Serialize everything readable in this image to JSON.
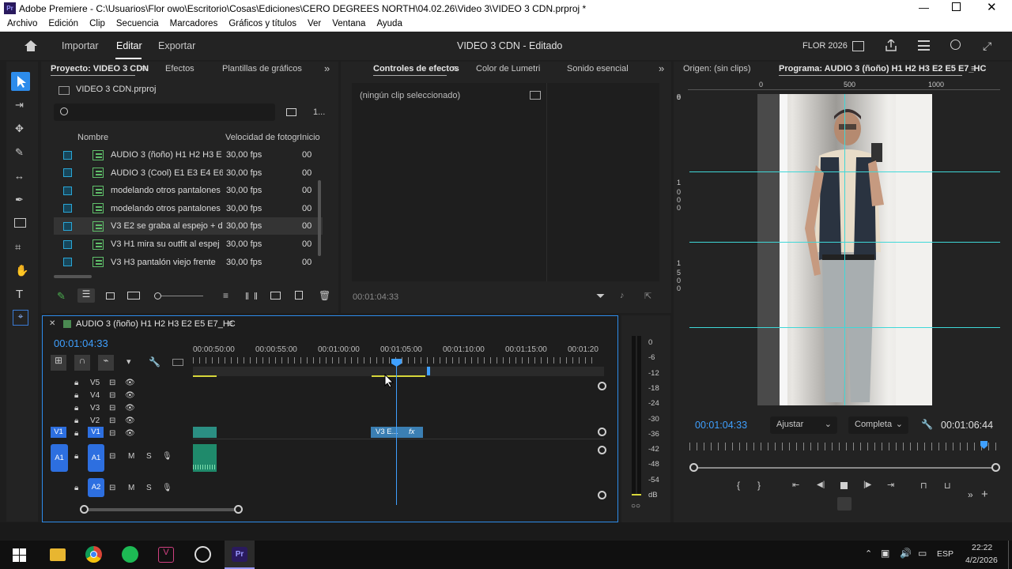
{
  "window": {
    "title": "Adobe Premiere - C:\\Usuarios\\Flor owo\\Escritorio\\Cosas\\Ediciones\\CERO DEGREES NORTH\\04.02.26\\Video 3\\VIDEO 3 CDN.prproj *",
    "app_icon": "Pr"
  },
  "menu": [
    "Archivo",
    "Edición",
    "Clip",
    "Secuencia",
    "Marcadores",
    "Gráficos y títulos",
    "Ver",
    "Ventana",
    "Ayuda"
  ],
  "appbar": {
    "tabs": [
      "Importar",
      "Editar",
      "Exportar"
    ],
    "active_tab": "Editar",
    "center_title": "VIDEO 3 CDN - Editado",
    "user": "FLOR 2026"
  },
  "project": {
    "tabs": [
      "Proyecto: VIDEO 3 CDN",
      "Efectos",
      "Plantillas de gráficos"
    ],
    "file": "VIDEO 3 CDN.prproj",
    "item_count": "1...",
    "columns": [
      "Nombre",
      "Velocidad de fotogr",
      "Inicio"
    ],
    "items": [
      {
        "name": "AUDIO 3 (ñoño) H1 H2 H3 E",
        "fps": "30,00 fps",
        "start": "00"
      },
      {
        "name": "AUDIO 3 (Cool) E1 E3 E4 E6",
        "fps": "30,00 fps",
        "start": "00"
      },
      {
        "name": "modelando otros pantalones",
        "fps": "30,00 fps",
        "start": "00"
      },
      {
        "name": "modelando otros pantalones",
        "fps": "30,00 fps",
        "start": "00"
      },
      {
        "name": "V3 E2 se graba al espejo + d",
        "fps": "30,00 fps",
        "start": "00"
      },
      {
        "name": "V3 H1 mira su outfit al espej",
        "fps": "30,00 fps",
        "start": "00"
      },
      {
        "name": "V3 H3 pantalón viejo frente",
        "fps": "30,00 fps",
        "start": "00"
      }
    ]
  },
  "effects": {
    "tabs": [
      "Controles de efectos",
      "Color de Lumetri",
      "Sonido esencial"
    ],
    "no_clip": "(ningún clip seleccionado)",
    "timecode": "00:01:04:33"
  },
  "timeline": {
    "sequence": "AUDIO 3 (ñoño) H1 H2 H3 E2 E5 E7_HC",
    "timecode": "00:01:04:33",
    "ruler": [
      "00:00:50:00",
      "00:00:55:00",
      "00:01:00:00",
      "00:01:05:00",
      "00:01:10:00",
      "00:01:15:00",
      "00:01:20"
    ],
    "video_tracks": [
      "V5",
      "V4",
      "V3",
      "V2",
      "V1"
    ],
    "audio_tracks": [
      "A1",
      "A2"
    ],
    "source_v": "V1",
    "source_a": "A1",
    "clip_label": "V3 E...",
    "fx": "fx",
    "m": "M",
    "s": "S"
  },
  "meter": {
    "labels": [
      "0",
      "-6",
      "-12",
      "-18",
      "-24",
      "-30",
      "-36",
      "-42",
      "-48",
      "-54",
      "dB"
    ],
    "solo": "○○"
  },
  "source": {
    "tab": "Origen: (sin clips)"
  },
  "program": {
    "tab": "Programa: AUDIO 3 (ñoño) H1 H2 H3 E2 E5 E7_HC",
    "ruler": [
      "0",
      "500",
      "1000"
    ],
    "vruler": [
      "0",
      "5",
      "0",
      "0",
      "1",
      "0",
      "0",
      "0",
      "1",
      "5",
      "0",
      "0"
    ],
    "timecode": "00:01:04:33",
    "fit": "Ajustar",
    "quality": "Completa",
    "duration": "00:01:06:44"
  },
  "taskbar": {
    "time": "22:22",
    "date": "4/2/2026",
    "lang": "ESP"
  },
  "colors": {
    "accent": "#2d8ceb",
    "guide": "#3fd8d8",
    "panel": "#232323",
    "clip_v": "#2b8f83",
    "clip_a": "#1f8a6b"
  }
}
